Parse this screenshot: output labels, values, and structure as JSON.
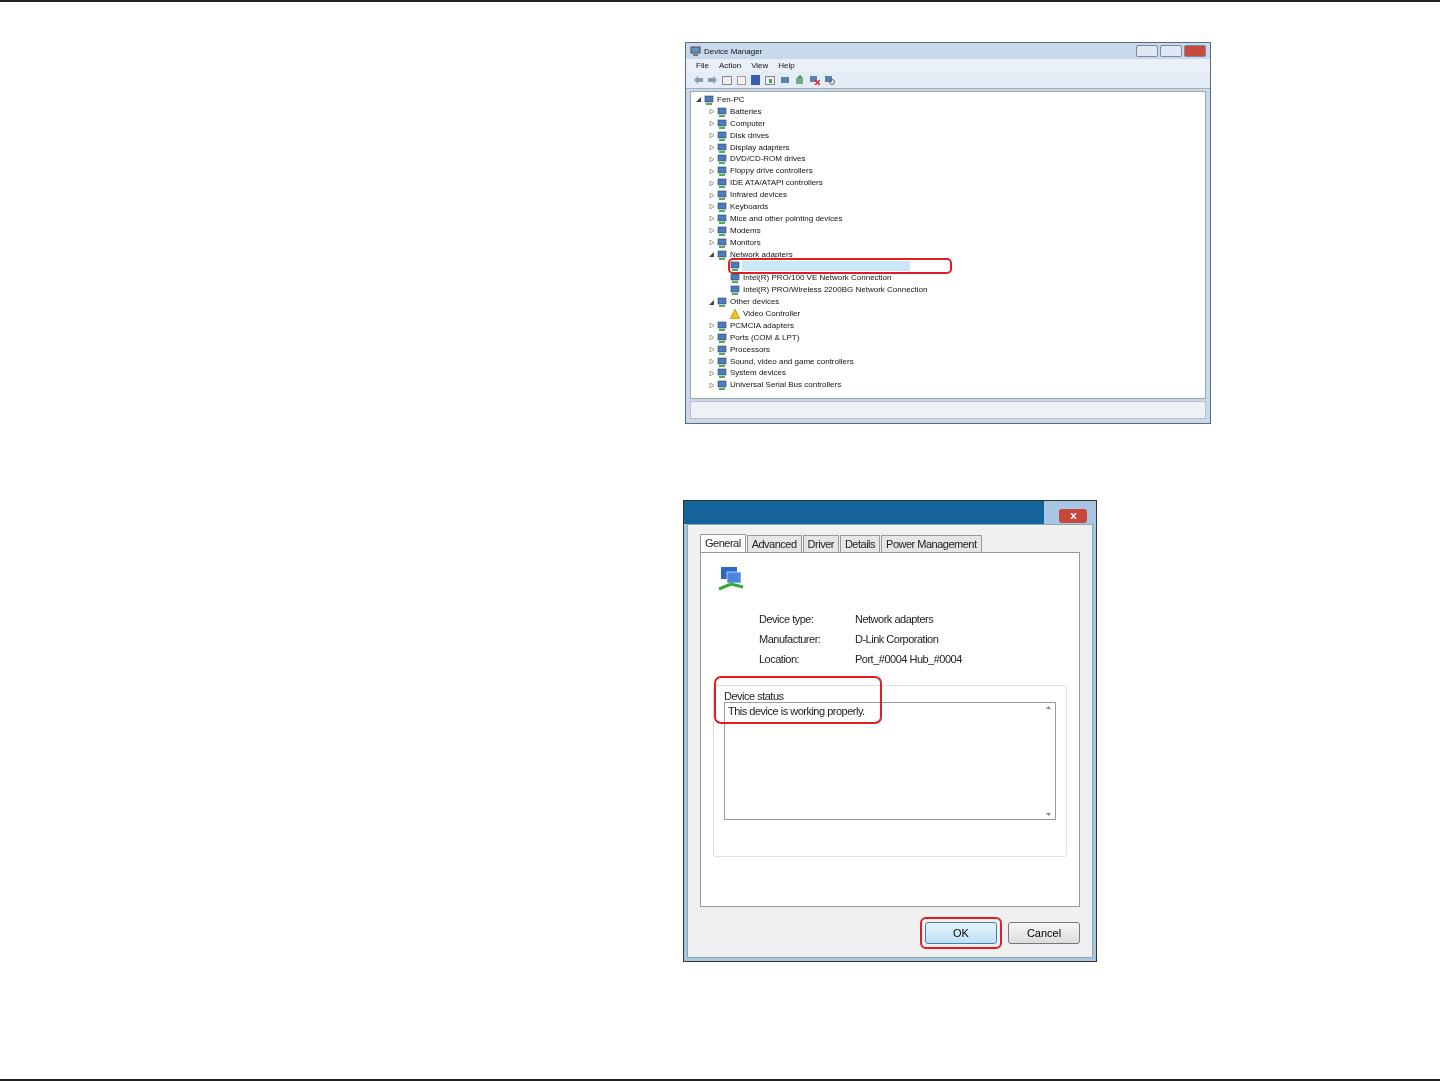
{
  "device_manager": {
    "title": "Device Manager",
    "menu": [
      "File",
      "Action",
      "View",
      "Help"
    ],
    "tree": {
      "label": "Fen-PC",
      "expanded": true,
      "children": [
        {
          "label": "Batteries",
          "expanded": false
        },
        {
          "label": "Computer",
          "expanded": false
        },
        {
          "label": "Disk drives",
          "expanded": false
        },
        {
          "label": "Display adapters",
          "expanded": false
        },
        {
          "label": "DVD/CD-ROM drives",
          "expanded": false
        },
        {
          "label": "Floppy drive controllers",
          "expanded": false
        },
        {
          "label": "IDE ATA/ATAPI controllers",
          "expanded": false
        },
        {
          "label": "Infrared devices",
          "expanded": false
        },
        {
          "label": "Keyboards",
          "expanded": false
        },
        {
          "label": "Mice and other pointing devices",
          "expanded": false
        },
        {
          "label": "Modems",
          "expanded": false
        },
        {
          "label": "Monitors",
          "expanded": false
        },
        {
          "label": "Network adapters",
          "expanded": true,
          "children": [
            {
              "selected": true,
              "circled": true
            },
            {
              "label": "Intel(R) PRO/100 VE Network Connection",
              "selected": false
            },
            {
              "label": "Intel(R) PRO/Wireless 2200BG Network Connection",
              "selected": false
            }
          ]
        },
        {
          "label": "Other devices",
          "expanded": true,
          "children": [
            {
              "label": "Video Controller",
              "selected": false,
              "warning": true
            }
          ]
        },
        {
          "label": "PCMCIA adapters",
          "expanded": false
        },
        {
          "label": "Ports (COM & LPT)",
          "expanded": false
        },
        {
          "label": "Processors",
          "expanded": false
        },
        {
          "label": "Sound, video and game controllers",
          "expanded": false
        },
        {
          "label": "System devices",
          "expanded": false
        },
        {
          "label": "Universal Serial Bus controllers",
          "expanded": false
        }
      ]
    }
  },
  "properties_dialog": {
    "tabs": [
      {
        "label": "General",
        "selected": true
      },
      {
        "label": "Advanced",
        "selected": false
      },
      {
        "label": "Driver",
        "selected": false
      },
      {
        "label": "Details",
        "selected": false
      },
      {
        "label": "Power Management",
        "selected": false
      }
    ],
    "fields": [
      {
        "label": "Device type:",
        "value": "Network adapters"
      },
      {
        "label": "Manufacturer:",
        "value": "D-Link Corporation"
      },
      {
        "label": "Location:",
        "value": "Port_#0004 Hub_#0004"
      }
    ],
    "device_status": {
      "label": "Device status",
      "text": "This device is working properly.",
      "circled": true
    },
    "buttons": [
      {
        "label": "OK",
        "default": true,
        "circled": true
      },
      {
        "label": "Cancel",
        "default": false,
        "circled": false
      }
    ]
  }
}
